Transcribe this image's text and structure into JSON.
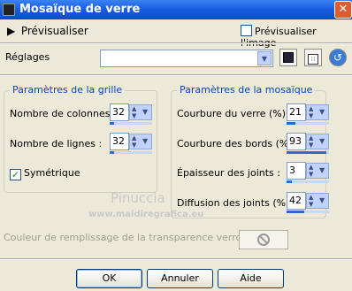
{
  "window": {
    "title": "Mosaïque de verre",
    "close_glyph": "✕"
  },
  "preview": {
    "toggle_label": "Prévisualiser",
    "checkbox_label": "Prévisualiser l'image",
    "checkbox_checked": false
  },
  "settings": {
    "label": "Réglages",
    "preset_value": ""
  },
  "grid_group": {
    "title": "Paramètres de la grille",
    "columns_label": "Nombre de colonnes :",
    "columns_value": "32",
    "rows_label": "Nombre de lignes :",
    "rows_value": "32",
    "symmetric_label": "Symétrique",
    "symmetric_checked": true
  },
  "mosaic_group": {
    "title": "Paramètres de la mosaïque",
    "glass_curvature_label": "Courbure du verre (%) :",
    "glass_curvature_value": "21",
    "edge_curvature_label": "Courbure des bords (%) :",
    "edge_curvature_value": "93",
    "grout_width_label": "Épaisseur des joints :",
    "grout_width_value": "3",
    "grout_diffusion_label": "Diffusion des joints (%) :",
    "grout_diffusion_value": "42"
  },
  "watermark": {
    "line1": "Pinuccia",
    "line2": "www.maidiregrafica.eu"
  },
  "fill": {
    "label": "Couleur de remplissage de la transparence verrouillée :"
  },
  "buttons": {
    "ok": "OK",
    "cancel": "Annuler",
    "help": "Aide"
  },
  "icons": {
    "app": "app-icon",
    "preview_arrow": "triangle-right-icon",
    "save": "floppy-disk-icon",
    "random": "dice-icon",
    "reset": "reset-arrow-icon",
    "no_color": "no-color-icon"
  },
  "colors": {
    "title_bar": "#0b4ad0",
    "group_title": "#0046d5",
    "dialog_bg": "#ece9d8"
  }
}
